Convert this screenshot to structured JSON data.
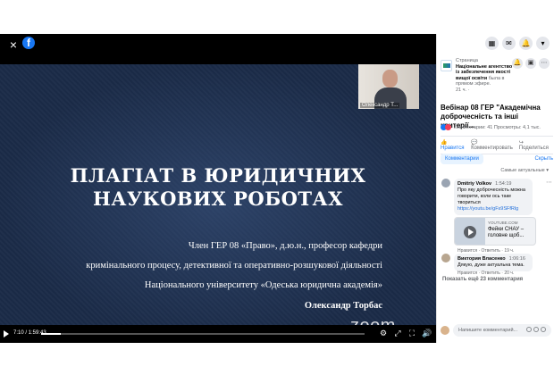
{
  "player": {
    "close_glyph": "×",
    "logo_letter": "f",
    "cam_name": "Олександр Т...",
    "title_line1": "ПЛАГІАТ В ЮРИДИЧНИХ",
    "title_line2": "НАУКОВИХ РОБОТАХ",
    "sub_line1": "Член ГЕР 08 «Право», д.ю.н., професор кафедри",
    "sub_line2": "кримінального процесу, детективної та оперативно-розшукової діяльності",
    "sub_line3": "Національного університету «Одеська юридична академія»",
    "sub_line4": "Олександр Торбас",
    "zoom_watermark": "zoom",
    "time": "7:10 / 1:59:43",
    "progress_fraction": 0.06
  },
  "sidebar": {
    "page_label": "Страница",
    "page_name": "Національне агентство із забезпечення якості вищої освіти",
    "page_status": "была в прямом эфире.",
    "page_time": "21 ч. · ",
    "video_title": "Вебінар 08 ГЕР \"Академічна доброчесність та інші критерії...",
    "stats_text": "Комментарии: 41  Просмотры: 4,1 тыс.",
    "like_label": "Нравится",
    "comment_label": "Комментировать",
    "share_label": "Поделиться",
    "tab_comments": "Комментарии",
    "tab_hide": "Скрыть",
    "sort_label": "Самые актуальные ▾",
    "comments": [
      {
        "author": "Dmitriy Volkov",
        "time": "1:54:19",
        "text": "Про яку доброчесність можна говорити, коли ось таке твориться",
        "link": "https://youtu.be/gFs9SFfRlg",
        "preview_source": "YOUTUBE.COM",
        "preview_title": "Фейки СНАУ – головне щоб...",
        "meta": "Нравится · Ответить · 19 ч."
      },
      {
        "author": "Виктория Власенко",
        "time": "1:06:16",
        "text": "Дякую, дуже актуальна тема.",
        "meta": "Нравится · Ответить · 20 ч."
      }
    ],
    "more_comments": "Показать ещё 23 комментария",
    "write_placeholder": "Напишите комментарий..."
  }
}
